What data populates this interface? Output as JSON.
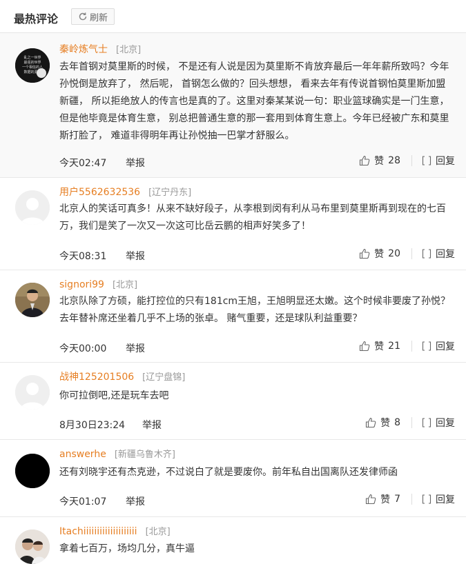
{
  "header": {
    "title": "最热评论",
    "refresh_label": "刷新"
  },
  "labels": {
    "like": "赞",
    "report": "举报",
    "reply": "回复"
  },
  "comments": [
    {
      "user": "秦岭炼气士",
      "location": "[北京]",
      "content": "去年首钢对莫里斯的时候， 不是还有人说是因为莫里斯不肯放弃最后一年年薪所致吗？今年孙悦倒是放弃了， 然后呢， 首钢怎么做的？回头想想， 看来去年有传说首钢怕莫里斯加盟新疆， 所以拒绝放人的传言也是真的了。这里对秦某某说一句：职业篮球确实是一门生意， 但是他毕竟是体育生意， 别总把普通生意的那一套用到体育生意上。今年已经被广东和莫里斯打脸了， 难道非得明年再让孙悦抽一巴掌才舒服么。",
      "time": "今天02:47",
      "likes": "28",
      "avatar_text": [
        "乱之一世界",
        "最强的世界",
        "一个相信的人",
        "数据的源语"
      ]
    },
    {
      "user": "用户5562632536",
      "location": "[辽宁丹东]",
      "content": "北京人的笑话可真多！从来不缺好段子，从李根到闵有利从马布里到莫里斯再到现在的七百万，我们是笑了一次又一次这可比岳云鹏的相声好笑多了！",
      "time": "今天08:31",
      "likes": "20"
    },
    {
      "user": "signori99",
      "location": "[北京]",
      "content": "北京队除了方硕，能打控位的只有181cm王旭，王旭明显还太嫩。这个时候非要废了孙悦？去年替补席还坐着几乎不上场的张卓。 赌气重要，还是球队利益重要？",
      "time": "今天00:00",
      "likes": "21"
    },
    {
      "user": "战神125201506",
      "location": "[辽宁盘锦]",
      "content": "你可拉倒吧,还是玩车去吧",
      "time": "8月30日23:24",
      "likes": "8"
    },
    {
      "user": "answerhe",
      "location": "[新疆乌鲁木齐]",
      "content": "还有刘晓宇还有杰克逊，不过说白了就是要废你。前年私自出国离队还发律师函",
      "time": "今天01:07",
      "likes": "7"
    },
    {
      "user": "Itachiiiiiiiiiiiiiiiiiiii",
      "location": "[北京]",
      "content": "拿着七百万，场均几分，真牛逼"
    }
  ],
  "colors": {
    "username": "#e67e22",
    "location": "#999999",
    "divider": "#e8e8e8"
  }
}
